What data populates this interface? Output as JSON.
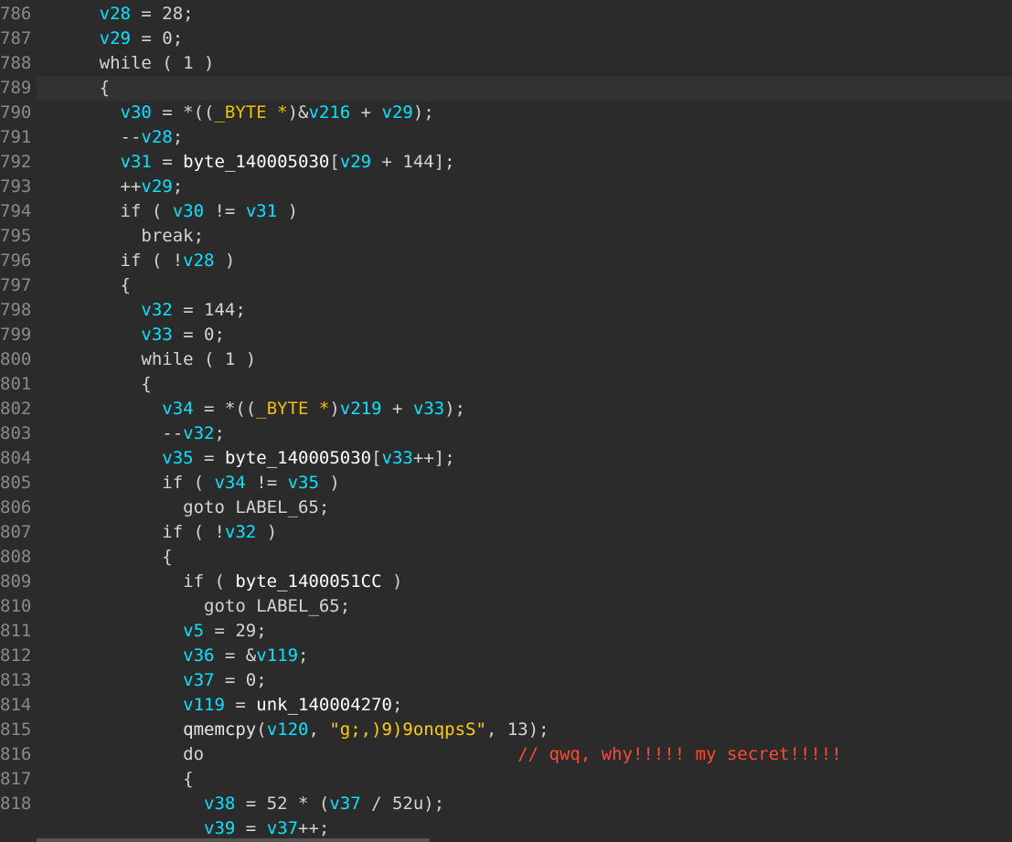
{
  "gutter": {
    "line_numbers": [
      "786",
      "787",
      "788",
      "789",
      "790",
      "791",
      "792",
      "793",
      "794",
      "795",
      "796",
      "797",
      "798",
      "799",
      "800",
      "801",
      "802",
      "803",
      "804",
      "805",
      "806",
      "807",
      "808",
      "809",
      "810",
      "811",
      "812",
      "813",
      "814",
      "815",
      "816",
      "817",
      "818",
      ""
    ]
  },
  "lines": [
    {
      "indent": "      ",
      "tokens": [
        {
          "t": "v28",
          "k": "var"
        },
        {
          "t": " = 28;",
          "k": "op"
        }
      ]
    },
    {
      "indent": "      ",
      "tokens": [
        {
          "t": "v29",
          "k": "var"
        },
        {
          "t": " = 0;",
          "k": "op"
        }
      ]
    },
    {
      "indent": "      ",
      "tokens": [
        {
          "t": "while ( 1 )",
          "k": "kw"
        }
      ]
    },
    {
      "indent": "      ",
      "tokens": [
        {
          "t": "{",
          "k": "op"
        }
      ],
      "current": true
    },
    {
      "indent": "        ",
      "tokens": [
        {
          "t": "v30",
          "k": "var"
        },
        {
          "t": " = *((",
          "k": "op"
        },
        {
          "t": "_BYTE *",
          "k": "type"
        },
        {
          "t": ")&",
          "k": "op"
        },
        {
          "t": "v216",
          "k": "var"
        },
        {
          "t": " + ",
          "k": "op"
        },
        {
          "t": "v29",
          "k": "var"
        },
        {
          "t": ");",
          "k": "op"
        }
      ]
    },
    {
      "indent": "        ",
      "tokens": [
        {
          "t": "--",
          "k": "op"
        },
        {
          "t": "v28",
          "k": "var"
        },
        {
          "t": ";",
          "k": "op"
        }
      ]
    },
    {
      "indent": "        ",
      "tokens": [
        {
          "t": "v31",
          "k": "var"
        },
        {
          "t": " = ",
          "k": "op"
        },
        {
          "t": "byte_140005030",
          "k": "sym"
        },
        {
          "t": "[",
          "k": "op"
        },
        {
          "t": "v29",
          "k": "var"
        },
        {
          "t": " + 144];",
          "k": "op"
        }
      ]
    },
    {
      "indent": "        ",
      "tokens": [
        {
          "t": "++",
          "k": "op"
        },
        {
          "t": "v29",
          "k": "var"
        },
        {
          "t": ";",
          "k": "op"
        }
      ]
    },
    {
      "indent": "        ",
      "tokens": [
        {
          "t": "if ( ",
          "k": "kw"
        },
        {
          "t": "v30",
          "k": "var"
        },
        {
          "t": " != ",
          "k": "op"
        },
        {
          "t": "v31",
          "k": "var"
        },
        {
          "t": " )",
          "k": "op"
        }
      ]
    },
    {
      "indent": "          ",
      "tokens": [
        {
          "t": "break;",
          "k": "kw"
        }
      ]
    },
    {
      "indent": "        ",
      "tokens": [
        {
          "t": "if ( !",
          "k": "kw"
        },
        {
          "t": "v28",
          "k": "var"
        },
        {
          "t": " )",
          "k": "op"
        }
      ]
    },
    {
      "indent": "        ",
      "tokens": [
        {
          "t": "{",
          "k": "op"
        }
      ]
    },
    {
      "indent": "          ",
      "tokens": [
        {
          "t": "v32",
          "k": "var"
        },
        {
          "t": " = 144;",
          "k": "op"
        }
      ]
    },
    {
      "indent": "          ",
      "tokens": [
        {
          "t": "v33",
          "k": "var"
        },
        {
          "t": " = 0;",
          "k": "op"
        }
      ]
    },
    {
      "indent": "          ",
      "tokens": [
        {
          "t": "while ( 1 )",
          "k": "kw"
        }
      ]
    },
    {
      "indent": "          ",
      "tokens": [
        {
          "t": "{",
          "k": "op"
        }
      ]
    },
    {
      "indent": "            ",
      "tokens": [
        {
          "t": "v34",
          "k": "var"
        },
        {
          "t": " = *((",
          "k": "op"
        },
        {
          "t": "_BYTE *",
          "k": "type"
        },
        {
          "t": ")",
          "k": "op"
        },
        {
          "t": "v219",
          "k": "var"
        },
        {
          "t": " + ",
          "k": "op"
        },
        {
          "t": "v33",
          "k": "var"
        },
        {
          "t": ");",
          "k": "op"
        }
      ]
    },
    {
      "indent": "            ",
      "tokens": [
        {
          "t": "--",
          "k": "op"
        },
        {
          "t": "v32",
          "k": "var"
        },
        {
          "t": ";",
          "k": "op"
        }
      ]
    },
    {
      "indent": "            ",
      "tokens": [
        {
          "t": "v35",
          "k": "var"
        },
        {
          "t": " = ",
          "k": "op"
        },
        {
          "t": "byte_140005030",
          "k": "sym"
        },
        {
          "t": "[",
          "k": "op"
        },
        {
          "t": "v33",
          "k": "var"
        },
        {
          "t": "++];",
          "k": "op"
        }
      ]
    },
    {
      "indent": "            ",
      "tokens": [
        {
          "t": "if ( ",
          "k": "kw"
        },
        {
          "t": "v34",
          "k": "var"
        },
        {
          "t": " != ",
          "k": "op"
        },
        {
          "t": "v35",
          "k": "var"
        },
        {
          "t": " )",
          "k": "op"
        }
      ]
    },
    {
      "indent": "              ",
      "tokens": [
        {
          "t": "goto LABEL_65;",
          "k": "kw"
        }
      ]
    },
    {
      "indent": "            ",
      "tokens": [
        {
          "t": "if ( !",
          "k": "kw"
        },
        {
          "t": "v32",
          "k": "var"
        },
        {
          "t": " )",
          "k": "op"
        }
      ]
    },
    {
      "indent": "            ",
      "tokens": [
        {
          "t": "{",
          "k": "op"
        }
      ]
    },
    {
      "indent": "              ",
      "tokens": [
        {
          "t": "if ( ",
          "k": "kw"
        },
        {
          "t": "byte_1400051CC",
          "k": "sym"
        },
        {
          "t": " )",
          "k": "op"
        }
      ]
    },
    {
      "indent": "                ",
      "tokens": [
        {
          "t": "goto LABEL_65;",
          "k": "kw"
        }
      ]
    },
    {
      "indent": "              ",
      "tokens": [
        {
          "t": "v5",
          "k": "var"
        },
        {
          "t": " = 29;",
          "k": "op"
        }
      ]
    },
    {
      "indent": "              ",
      "tokens": [
        {
          "t": "v36",
          "k": "var"
        },
        {
          "t": " = &",
          "k": "op"
        },
        {
          "t": "v119",
          "k": "var"
        },
        {
          "t": ";",
          "k": "op"
        }
      ]
    },
    {
      "indent": "              ",
      "tokens": [
        {
          "t": "v37",
          "k": "var"
        },
        {
          "t": " = 0;",
          "k": "op"
        }
      ]
    },
    {
      "indent": "              ",
      "tokens": [
        {
          "t": "v119",
          "k": "var"
        },
        {
          "t": " = ",
          "k": "op"
        },
        {
          "t": "unk_140004270",
          "k": "sym"
        },
        {
          "t": ";",
          "k": "op"
        }
      ]
    },
    {
      "indent": "              ",
      "tokens": [
        {
          "t": "qmemcpy",
          "k": "fn"
        },
        {
          "t": "(",
          "k": "op"
        },
        {
          "t": "v120",
          "k": "var"
        },
        {
          "t": ", ",
          "k": "op"
        },
        {
          "t": "\"g;,)9)9onqpsS\"",
          "k": "str"
        },
        {
          "t": ", 13);",
          "k": "op"
        }
      ]
    },
    {
      "indent": "              ",
      "tokens": [
        {
          "t": "do                              ",
          "k": "kw"
        },
        {
          "t": "// qwq, why!!!!! my secret!!!!!",
          "k": "cmt"
        }
      ]
    },
    {
      "indent": "              ",
      "tokens": [
        {
          "t": "{",
          "k": "op"
        }
      ]
    },
    {
      "indent": "                ",
      "tokens": [
        {
          "t": "v38",
          "k": "var"
        },
        {
          "t": " = 52 * (",
          "k": "op"
        },
        {
          "t": "v37",
          "k": "var"
        },
        {
          "t": " / 52u);",
          "k": "op"
        }
      ]
    },
    {
      "indent": "                ",
      "tokens": [
        {
          "t": "v39",
          "k": "var"
        },
        {
          "t": " = ",
          "k": "op"
        },
        {
          "t": "v37",
          "k": "var"
        },
        {
          "t": "++;",
          "k": "op"
        }
      ]
    }
  ]
}
